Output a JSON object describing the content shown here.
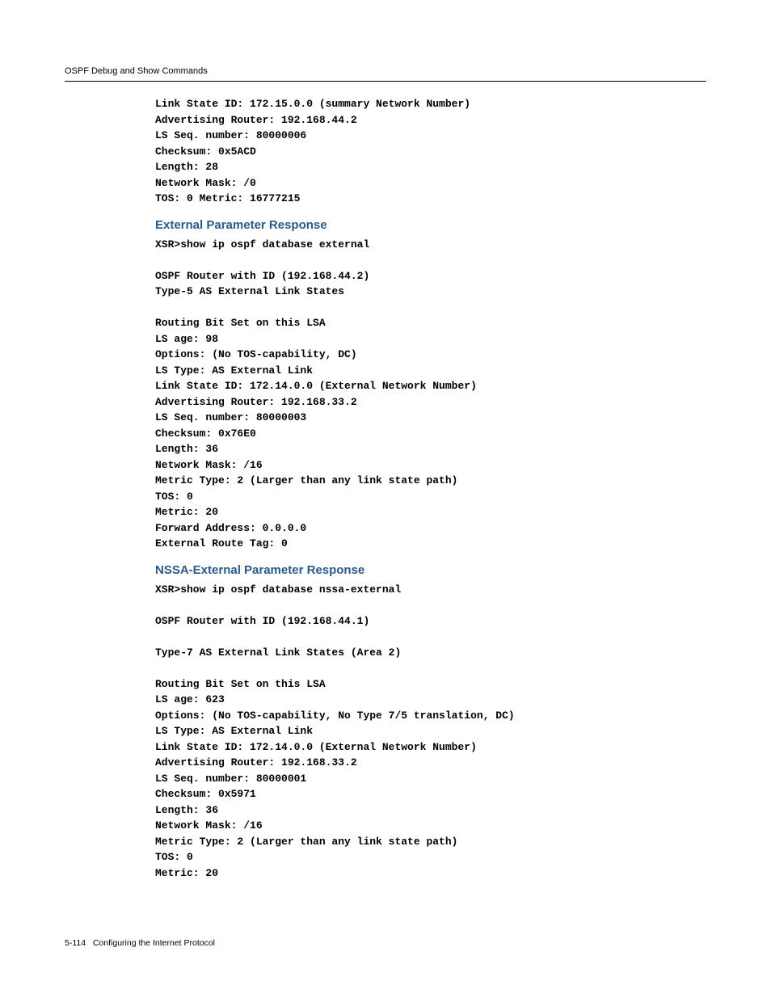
{
  "header": {
    "section_title": "OSPF Debug and Show Commands"
  },
  "block1": {
    "lines": [
      "Link State ID: 172.15.0.0 (summary Network Number)",
      "Advertising Router: 192.168.44.2",
      "LS Seq. number: 80000006",
      "Checksum: 0x5ACD",
      "Length: 28",
      "Network Mask: /0",
      "TOS: 0 Metric: 16777215"
    ]
  },
  "heading1": "External Parameter Response",
  "block2": {
    "cmd": "XSR>show ip ospf database external",
    "lines": [
      "OSPF Router with ID (192.168.44.2)",
      "Type-5 AS External Link States",
      "",
      "Routing Bit Set on this LSA",
      "LS age: 98",
      "Options: (No TOS-capability, DC)",
      "LS Type: AS External Link",
      "Link State ID: 172.14.0.0 (External Network Number)",
      "Advertising Router: 192.168.33.2",
      "LS Seq. number: 80000003",
      "Checksum: 0x76E0",
      "Length: 36",
      "Network Mask: /16",
      "Metric Type: 2 (Larger than any link state path)",
      "TOS: 0",
      "Metric: 20",
      "Forward Address: 0.0.0.0",
      "External Route Tag: 0"
    ]
  },
  "heading2": "NSSA-External Parameter Response",
  "block3": {
    "cmd": "XSR>show ip ospf database nssa-external",
    "lines": [
      "OSPF Router with ID (192.168.44.1)",
      "",
      "Type-7 AS External Link States (Area 2)",
      "",
      "Routing Bit Set on this LSA",
      "LS age: 623",
      "Options: (No TOS-capability, No Type 7/5 translation, DC)",
      "LS Type: AS External Link",
      "Link State ID: 172.14.0.0 (External Network Number)",
      "Advertising Router: 192.168.33.2",
      "LS Seq. number: 80000001",
      "Checksum: 0x5971",
      "Length: 36",
      "Network Mask: /16",
      "Metric Type: 2 (Larger than any link state path)",
      "TOS: 0",
      "Metric: 20"
    ]
  },
  "footer": {
    "page": "5-114",
    "label": "Configuring the Internet Protocol"
  }
}
